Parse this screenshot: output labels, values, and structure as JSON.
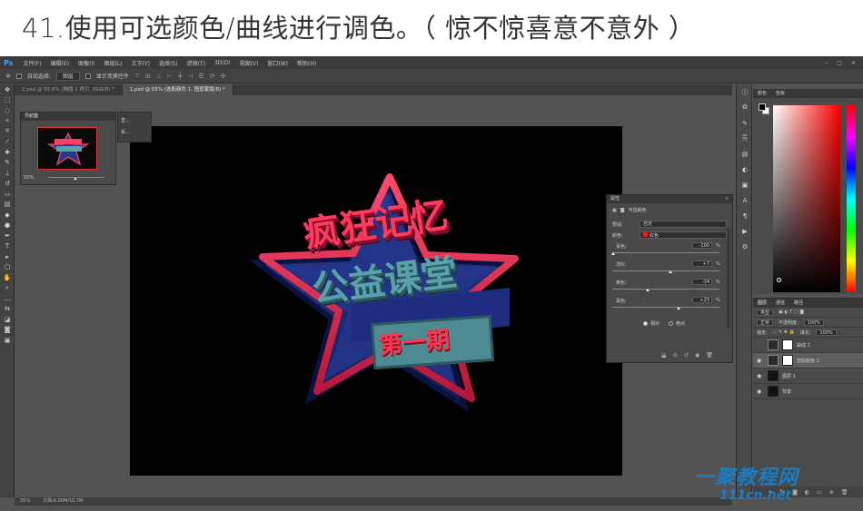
{
  "caption": "41.使用可选颜色/曲线进行调色。（ 惊不惊喜意不意外 ）",
  "app": {
    "logo": "Ps"
  },
  "menu": [
    "文件(F)",
    "编辑(E)",
    "图像(I)",
    "图层(L)",
    "文字(Y)",
    "选择(S)",
    "滤镜(T)",
    "3D(D)",
    "视图(V)",
    "窗口(W)",
    "帮助(H)"
  ],
  "options": {
    "auto_select": "自动选择:",
    "auto_select_value": "图层",
    "show_transform": "显示变换控件"
  },
  "tabs": [
    "2.psd @ 55.6% (椭圆 1 拷贝, RGB/8) *",
    "1.psd @ 55% (选取颜色 1, 图层蒙版/8) *"
  ],
  "navigator": {
    "title": "导航器",
    "zoom": "55%"
  },
  "mini_panel": {
    "items": [
      "直...",
      "系..."
    ]
  },
  "artwork": {
    "line1": "疯狂记忆",
    "line2": "公益课堂",
    "badge": "第一期"
  },
  "properties": {
    "title": "属性",
    "subtitle": "可选颜色",
    "preset_label": "预设:",
    "preset_value": "自定",
    "colors_label": "颜色:",
    "colors_value": "红色",
    "sliders": [
      {
        "label": "青色:",
        "value": "-100"
      },
      {
        "label": "洋红:",
        "value": "+7"
      },
      {
        "label": "黄色:",
        "value": "-34"
      },
      {
        "label": "黑色:",
        "value": "+23"
      }
    ],
    "pct": "%",
    "relative": "相对",
    "absolute": "绝对"
  },
  "color_panel": {
    "tab1": "颜色",
    "tab2": "色板"
  },
  "layers": {
    "tabs": [
      "图层",
      "通道",
      "路径"
    ],
    "kind": "类型",
    "blend": "正常",
    "opacity_label": "不透明度:",
    "opacity": "100%",
    "lock_label": "锁定:",
    "fill_label": "填充:",
    "fill": "100%",
    "items": [
      {
        "name": "曲线 1",
        "type": "adj",
        "selected": false
      },
      {
        "name": "选取颜色 1",
        "type": "adj",
        "selected": true
      },
      {
        "name": "图层 1",
        "type": "img",
        "selected": false
      },
      {
        "name": "背景",
        "type": "bg",
        "selected": false
      }
    ]
  },
  "status": {
    "zoom": "55%",
    "doc": "文档:6.00M/10.7M"
  },
  "watermark": {
    "line1": "一聚教程网",
    "line2": "111cn.net"
  }
}
